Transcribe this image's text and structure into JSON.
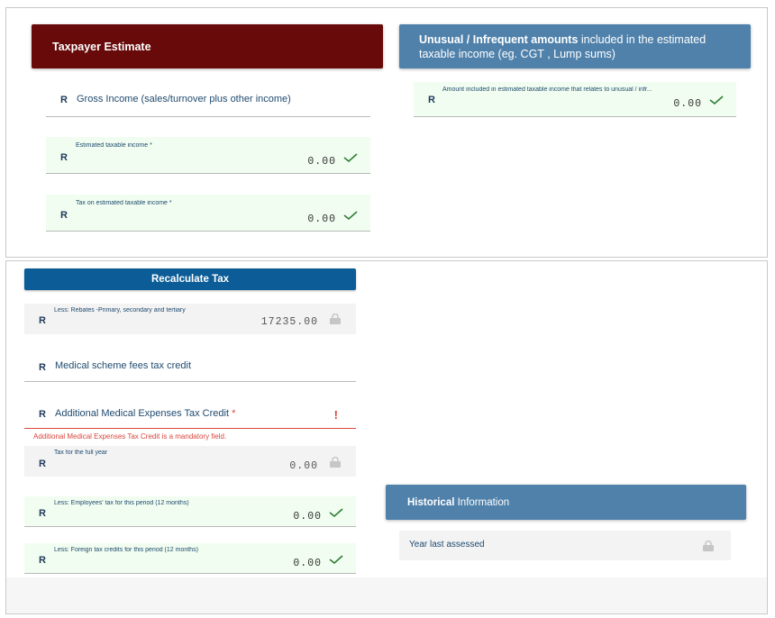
{
  "taxpayer": {
    "header": "Taxpayer Estimate",
    "gross": {
      "currency": "R",
      "label": "Gross Income (sales/turnover plus other income)"
    },
    "estimated": {
      "currency": "R",
      "label": "Estimated taxable income *",
      "value": "0.00"
    },
    "tax_on_estimated": {
      "currency": "R",
      "label": "Tax on estimated taxable income *",
      "value": "0.00"
    }
  },
  "unusual": {
    "header_bold": "Unusual / Infrequent amounts",
    "header_rest": " included in the estimated taxable income (eg. CGT , Lump sums)",
    "amount": {
      "currency": "R",
      "label": "Amount included in estimated taxable income that relates to unusual / infr...",
      "value": "0.00"
    }
  },
  "recalc": {
    "header": "Recalculate Tax",
    "rebates": {
      "currency": "R",
      "label": "Less: Rebates -Primary, secondary and tertiary",
      "value": "17235.00"
    },
    "medical_fees": {
      "currency": "R",
      "label": "Medical scheme fees tax credit"
    },
    "additional_medical": {
      "currency": "R",
      "label": "Additional Medical Expenses Tax Credit",
      "required_mark": "*",
      "error_icon": "!"
    },
    "error_message": "Additional Medical Expenses Tax Credit is a mandatory field.",
    "full_year": {
      "currency": "R",
      "label": "Tax for the full year",
      "value": "0.00"
    },
    "employees_tax": {
      "currency": "R",
      "label": "Less: Employees' tax for this period (12 months)",
      "value": "0.00"
    },
    "foreign_credits": {
      "currency": "R",
      "label": "Less: Foreign tax credits for this period (12 months)",
      "value": "0.00"
    }
  },
  "historical": {
    "header_bold": "Historical",
    "header_rest": " Information",
    "year_last": {
      "label": "Year last assessed"
    }
  },
  "icons": {
    "valid": "check-icon",
    "locked": "lock-icon",
    "error": "exclamation-icon"
  },
  "colors": {
    "taxpayer_header": "#680a0a",
    "info_header": "#4f81ab",
    "recalc_header": "#0b5c97",
    "valid": "#2e7d32",
    "error": "#d9463c",
    "valid_bg": "#f1fdf0"
  }
}
